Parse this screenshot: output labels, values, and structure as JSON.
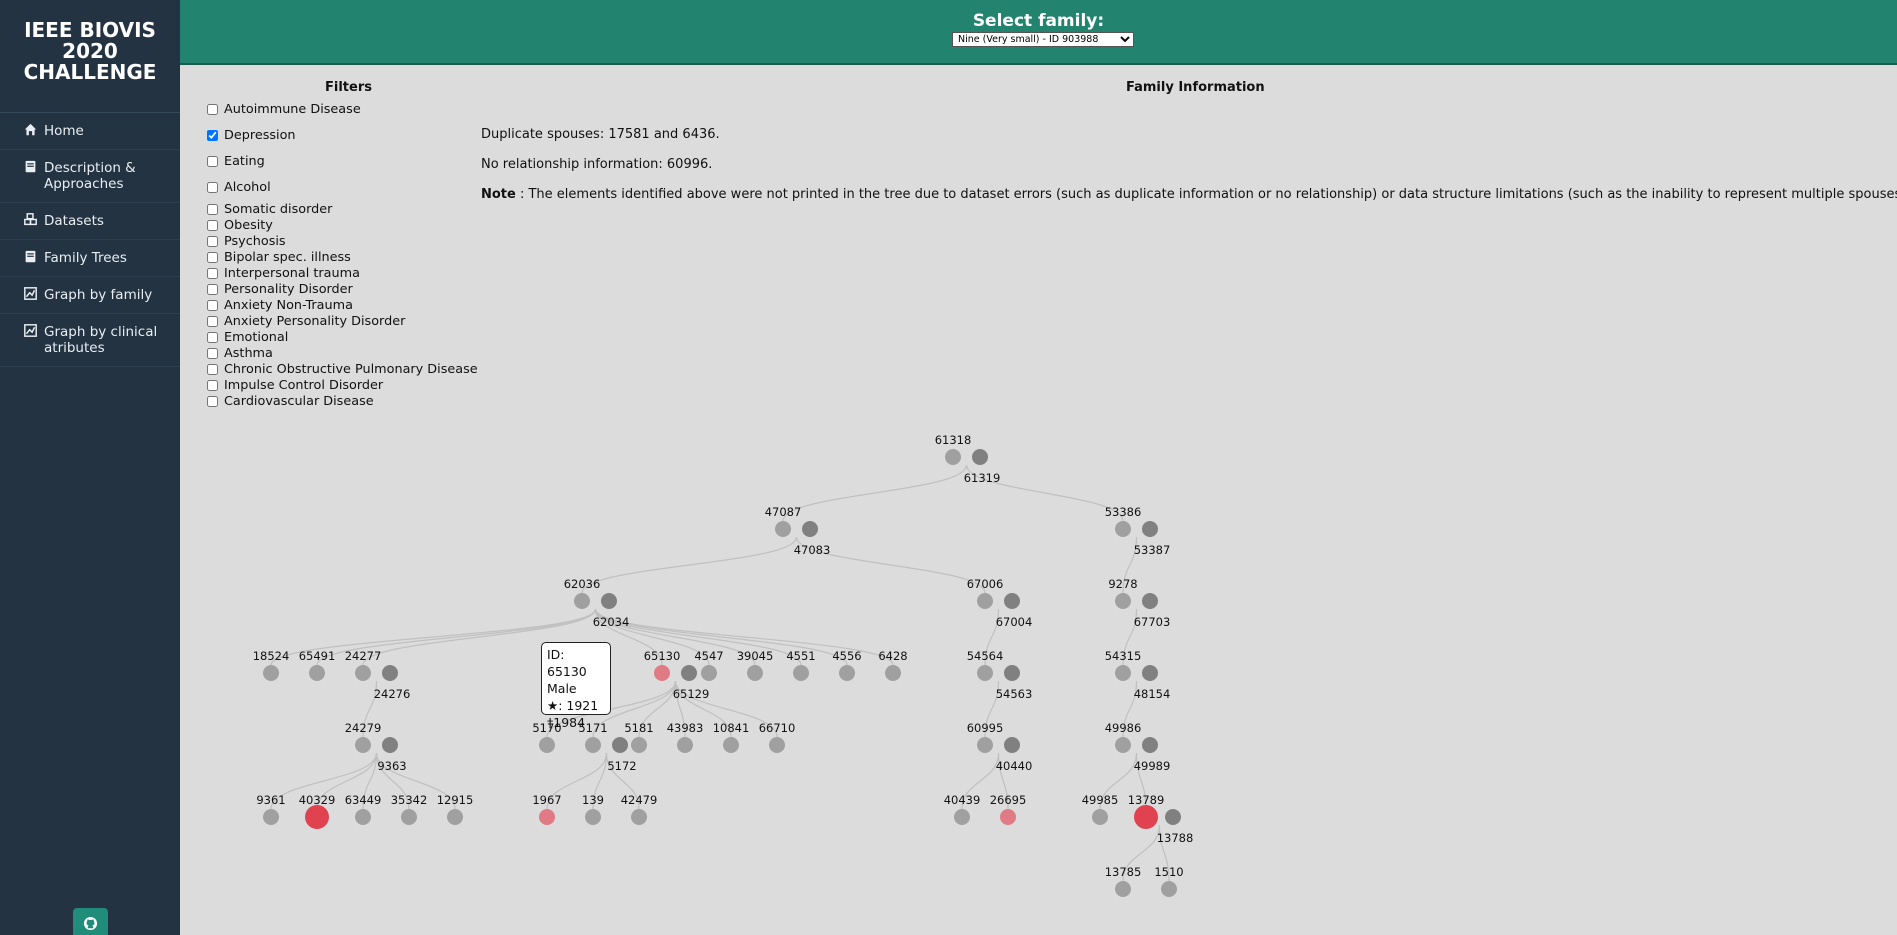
{
  "sidebar": {
    "brand": [
      "IEEE BIOVIS",
      "2020",
      "CHALLENGE"
    ],
    "items": [
      {
        "label": "Home",
        "icon": "home-icon"
      },
      {
        "label": "Description & Approaches",
        "icon": "book-icon"
      },
      {
        "label": "Datasets",
        "icon": "cubes-icon"
      },
      {
        "label": "Family Trees",
        "icon": "book-icon"
      },
      {
        "label": "Graph by family",
        "icon": "chart-icon"
      },
      {
        "label": "Graph by clinical atributes",
        "icon": "chart-icon"
      }
    ],
    "github_icon": "github-icon"
  },
  "header": {
    "title": "Select family:",
    "select_value": "Nine (Very small) - ID 903988"
  },
  "filters": {
    "title": "Filters",
    "items": [
      {
        "label": "Autoimmune Disease",
        "checked": false
      },
      {
        "label": "Depression",
        "checked": true
      },
      {
        "label": "Eating",
        "checked": false
      },
      {
        "label": "Alcohol",
        "checked": false
      },
      {
        "label": "Somatic disorder",
        "checked": false
      },
      {
        "label": "Obesity",
        "checked": false
      },
      {
        "label": "Psychosis",
        "checked": false
      },
      {
        "label": "Bipolar spec. illness",
        "checked": false
      },
      {
        "label": "Interpersonal trauma",
        "checked": false
      },
      {
        "label": "Personality Disorder",
        "checked": false
      },
      {
        "label": "Anxiety Non-Trauma",
        "checked": false
      },
      {
        "label": "Anxiety Personality Disorder",
        "checked": false
      },
      {
        "label": "Emotional",
        "checked": false
      },
      {
        "label": "Asthma",
        "checked": false
      },
      {
        "label": "Chronic Obstructive Pulmonary Disease",
        "checked": false
      },
      {
        "label": "Impulse Control Disorder",
        "checked": false
      },
      {
        "label": "Cardiovascular Disease",
        "checked": false
      }
    ]
  },
  "info": {
    "title": "Family Information",
    "duplicate": "Duplicate spouses: 17581 and 6436.",
    "norelation": "No relationship information: 60996.",
    "note_label": "Note",
    "note_text": " : The elements identified above were not printed in the tree due to dataset errors (such as duplicate information or no relationship) or data structure limitations (such as the inability to represent multiple spouses)."
  },
  "tooltip": {
    "lines": [
      "ID: 65130",
      "Male",
      "★: 1921",
      "†1984"
    ]
  },
  "colors": {
    "sidebar": "#243342",
    "header": "#22846f",
    "node": "#a0a0a0",
    "spouse": "#808080",
    "affected": "#e0424f",
    "affected_light": "#e07a85",
    "link": "#c0c0c0"
  },
  "tree": {
    "couples": [
      {
        "id": "61318",
        "spouse": "61319"
      },
      {
        "id": "47087",
        "spouse": "47083"
      },
      {
        "id": "53386",
        "spouse": "53387"
      },
      {
        "id": "62036",
        "spouse": "62034"
      },
      {
        "id": "67006",
        "spouse": "67004"
      },
      {
        "id": "9278",
        "spouse": "67703"
      },
      {
        "id": "24277",
        "spouse": "24276"
      },
      {
        "id": "65130",
        "spouse": "65129"
      },
      {
        "id": "54564",
        "spouse": "54563"
      },
      {
        "id": "54315",
        "spouse": "48154"
      },
      {
        "id": "24279",
        "spouse": "9363"
      },
      {
        "id": "5171",
        "spouse": "5172"
      },
      {
        "id": "60995",
        "spouse": "40440"
      },
      {
        "id": "49986",
        "spouse": "49989"
      },
      {
        "id": "13789",
        "spouse": "13788"
      }
    ],
    "singles": [
      "18524",
      "65491",
      "4547",
      "39045",
      "4551",
      "4556",
      "6428",
      "5170",
      "5181",
      "43983",
      "10841",
      "66710",
      "9361",
      "40329",
      "63449",
      "35342",
      "12915",
      "1967",
      "139",
      "42479",
      "40439",
      "26695",
      "49985",
      "13785",
      "1510"
    ],
    "affected": [
      "40329",
      "13789"
    ],
    "affected_light": [
      "65130",
      "1967",
      "26695"
    ]
  }
}
